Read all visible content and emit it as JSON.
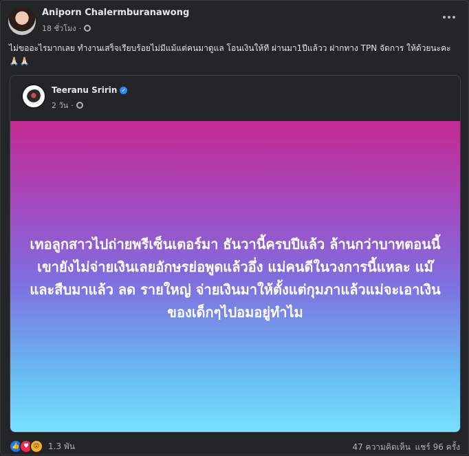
{
  "post": {
    "author": "Aniporn Chalermburanawong",
    "time": "18 ชั่วโมง",
    "separator": "·",
    "caption": "ไม่ขออะไรมากเลย ทำงานเสร็จเรียบร้อยไม่มีแม้แต่คนมาดูแล โอนเงินให้ที ผ่านมา1ปีแล้วว ฝากทาง TPN จัดการ ให้ด้วยนะคะ",
    "caption_emoji": "🙏🏻🙏🏻"
  },
  "shared_post": {
    "author": "Teeranu Sririn",
    "time": "2 วัน",
    "separator": "·",
    "banner_text": "เทอลูกสาวไปถ่ายพรีเซ็นเตอร์มา ธันวานี้ครบปีแล้ว ล้านกว่าบาทตอนนี้เขายังไม่จ่ายเงินเลยอักษรย่อพูดแล้วอึ่ง แม่คนดีในวงการนี้แหละ แม๊และสืบมาแล้ว ลด รายใหญ่ จ่ายเงินมาให้ตั้งแต่กุมภาแล้วแม่จะเอาเงินของเด็กๆไปอมอยู่ทำไม"
  },
  "footer": {
    "reaction_count": "1.3 พัน",
    "comments": "47 ความคิดเห็น",
    "shares": "แชร์ 96 ครั้ง"
  },
  "icons": {
    "like": "thumbs-up-icon",
    "love": "heart-icon",
    "wow": "wow-icon"
  },
  "colors": {
    "background": "#242526",
    "banner_top": "#c42a93",
    "banner_bottom": "#77e0ff",
    "verified": "#2d88ff"
  }
}
